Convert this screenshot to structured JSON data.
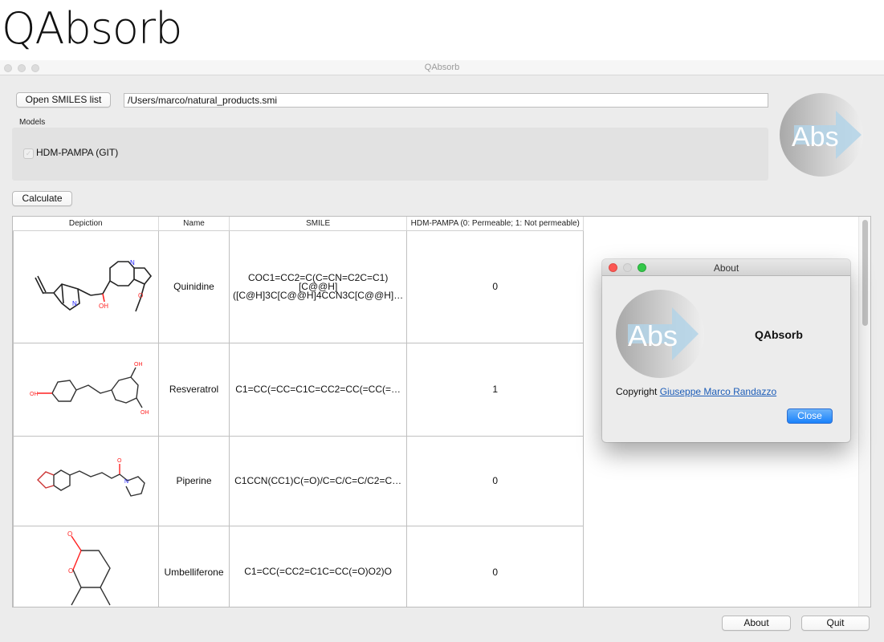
{
  "banner": {
    "title": "QAbsorb"
  },
  "window": {
    "title": "QAbsorb",
    "open_button": "Open SMILES list",
    "file_path": "/Users/marco/natural_products.smi",
    "models_label": "Models",
    "models": [
      {
        "label": "HDM-PAMPA (GIT)",
        "checked": false
      }
    ],
    "calculate_button": "Calculate",
    "logo_text": "Abs",
    "about_button": "About",
    "quit_button": "Quit"
  },
  "table": {
    "headers": [
      "Depiction",
      "Name",
      "SMILE",
      "HDM-PAMPA (0: Permeable; 1: Not permeable)"
    ],
    "rows": [
      {
        "name": "Quinidine",
        "smile": "COC1=CC2=C(C=CN=C2C=C1)[C@@H]([C@H]3C[C@@H]4CCN3C[C@@H]…",
        "smile_lines": [
          "COC1=CC2=C(C=CN=C2C=C1)",
          "[C@@H]",
          "([C@H]3C[C@@H]4CCN3C[C@@H]…"
        ],
        "value": "0",
        "depiction": "quinidine-structure"
      },
      {
        "name": "Resveratrol",
        "smile": "C1=CC(=CC=C1C=CC2=CC(=CC(=…",
        "value": "1",
        "depiction": "resveratrol-structure"
      },
      {
        "name": "Piperine",
        "smile": "C1CCN(CC1)C(=O)/C=C/C=C/C2=C…",
        "value": "0",
        "depiction": "piperine-structure"
      },
      {
        "name": "Umbelliferone",
        "smile": "C1=CC(=CC2=C1C=CC(=O)O2)O",
        "value": "0",
        "depiction": "umbelliferone-structure"
      }
    ],
    "atom_labels": {
      "n": "N",
      "oh": "OH",
      "o": "O"
    }
  },
  "about_dialog": {
    "title": "About",
    "app_name": "QAbsorb",
    "logo_text": "Abs",
    "copyright_prefix": "Copyright",
    "author_link": "Giuseppe Marco Randazzo",
    "close_button": "Close"
  },
  "colors": {
    "link": "#1d5db8",
    "accent_button": "#1a82fb",
    "close_red": "#fc5753",
    "zoom_green": "#34c84a",
    "heteroatom_o": "#ff2020",
    "heteroatom_n": "#2020ff"
  }
}
